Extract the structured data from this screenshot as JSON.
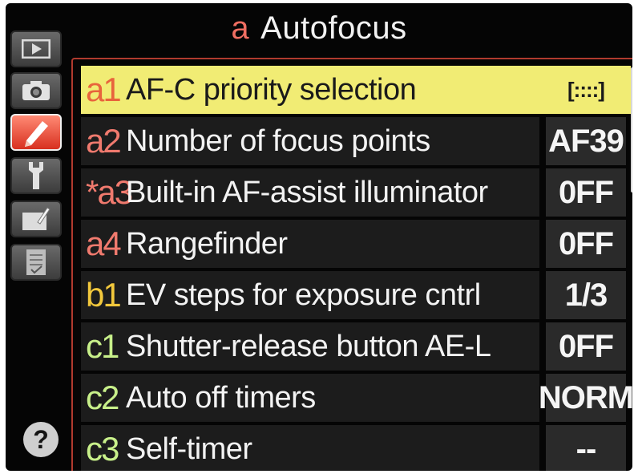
{
  "header": {
    "group_code": "a",
    "title": "Autofocus"
  },
  "sidebar": {
    "tabs": [
      {
        "icon": "playback-icon",
        "active": false
      },
      {
        "icon": "camera-icon",
        "active": false
      },
      {
        "icon": "pencil-icon",
        "active": true
      },
      {
        "icon": "wrench-icon",
        "active": false
      },
      {
        "icon": "retouch-icon",
        "active": false
      },
      {
        "icon": "my-menu-icon",
        "active": false
      }
    ],
    "help_label": "?"
  },
  "menu": {
    "items": [
      {
        "code": "a1",
        "label": "AF-C priority selection",
        "value": "[::::]",
        "selected": true,
        "code_color": "#e8643c"
      },
      {
        "code": "a2",
        "label": "Number of focus points",
        "value": "AF39",
        "selected": false,
        "code_color": "#f07a6e"
      },
      {
        "code": "*a3",
        "label": "Built-in AF-assist illuminator",
        "value": "0FF",
        "selected": false,
        "code_color": "#f07a6e"
      },
      {
        "code": "a4",
        "label": "Rangefinder",
        "value": "0FF",
        "selected": false,
        "code_color": "#f07a6e"
      },
      {
        "code": "b1",
        "label": "EV steps for exposure cntrl",
        "value": "1/3",
        "selected": false,
        "code_color": "#f2c83c"
      },
      {
        "code": "c1",
        "label": "Shutter-release button AE-L",
        "value": "0FF",
        "selected": false,
        "code_color": "#c8f08a"
      },
      {
        "code": "c2",
        "label": "Auto off timers",
        "value": "NORM",
        "selected": false,
        "code_color": "#c8f08a"
      },
      {
        "code": "c3",
        "label": "Self-timer",
        "value": "--",
        "selected": false,
        "code_color": "#c8f08a"
      }
    ]
  }
}
